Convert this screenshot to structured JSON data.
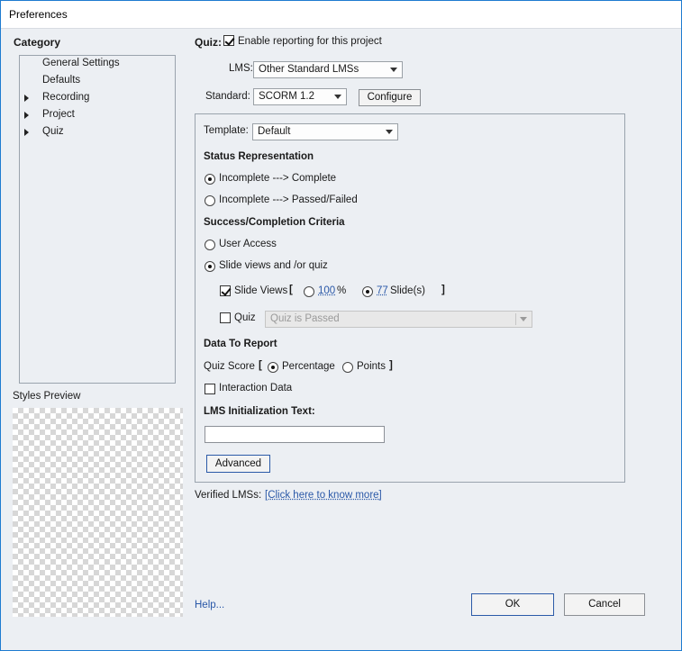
{
  "window": {
    "title": "Preferences"
  },
  "sidebar": {
    "category_title": "Category",
    "items": [
      {
        "label": "General Settings",
        "expandable": false
      },
      {
        "label": "Defaults",
        "expandable": false
      },
      {
        "label": "Recording",
        "expandable": true
      },
      {
        "label": "Project",
        "expandable": true
      },
      {
        "label": "Quiz",
        "expandable": true
      }
    ],
    "styles_preview_label": "Styles Preview"
  },
  "quiz": {
    "label": "Quiz:",
    "enable_reporting_label": "Enable reporting for this project",
    "enable_reporting_checked": true
  },
  "lms": {
    "label": "LMS:",
    "value": "Other Standard LMSs",
    "standard_label": "Standard:",
    "standard_value": "SCORM 1.2",
    "configure_label": "Configure"
  },
  "template": {
    "label": "Template:",
    "value": "Default"
  },
  "status": {
    "heading": "Status Representation",
    "option1": "Incomplete ---> Complete",
    "option2": "Incomplete ---> Passed/Failed",
    "selected": "option1"
  },
  "criteria": {
    "heading": "Success/Completion Criteria",
    "user_access": "User Access",
    "slide_views_quiz": "Slide views and /or quiz",
    "selected": "slide_views_quiz",
    "slide_views_label": "Slide Views",
    "slide_views_checked": true,
    "bracket_open": "[",
    "bracket_close": "]",
    "percent_value": "100",
    "percent_symbol": "%",
    "slides_value": "77",
    "slides_suffix": "Slide(s)",
    "slides_selected": true,
    "quiz_label": "Quiz",
    "quiz_checked": false,
    "quiz_dropdown_value": "Quiz is Passed"
  },
  "report": {
    "heading": "Data To Report",
    "quiz_score_label": "Quiz Score",
    "bracket_open": "[",
    "bracket_close": "]",
    "percentage": "Percentage",
    "points": "Points",
    "selected": "percentage",
    "interaction_data": "Interaction Data",
    "interaction_checked": false
  },
  "init_text": {
    "label": "LMS Initialization Text:",
    "value": ""
  },
  "advanced_label": "Advanced",
  "verified": {
    "label": "Verified LMSs:",
    "link": "[Click here to know more]"
  },
  "footer": {
    "help": "Help...",
    "ok": "OK",
    "cancel": "Cancel"
  }
}
